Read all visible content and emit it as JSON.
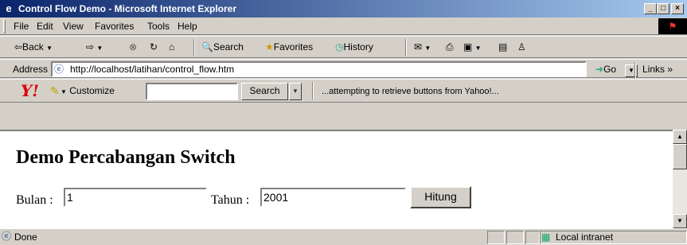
{
  "window": {
    "title": "Control Flow Demo - Microsoft Internet Explorer",
    "app_icon": "ie-icon",
    "controls": {
      "minimize": "_",
      "maximize": "□",
      "close": "×"
    }
  },
  "menu": {
    "items": [
      {
        "label": "File"
      },
      {
        "label": "Edit"
      },
      {
        "label": "View"
      },
      {
        "label": "Favorites"
      },
      {
        "label": "Tools"
      },
      {
        "label": "Help"
      }
    ]
  },
  "toolbar": {
    "back_label": "⇦Back",
    "search_label": "Search",
    "favorites_label": "Favorites",
    "history_label": "History"
  },
  "address": {
    "label": "Address",
    "url": "http://localhost/latihan/control_flow.htm",
    "go_label": "Go",
    "links_label": "Links"
  },
  "yahoo": {
    "logo": "Y!",
    "customize_label": "Customize",
    "search_button": "Search",
    "search_value": "",
    "message": "...attempting to retrieve buttons from Yahoo!..."
  },
  "page": {
    "heading": "Demo Percabangan Switch",
    "bulan_label": "Bulan :",
    "bulan_value": "1",
    "tahun_label": "Tahun :",
    "tahun_value": "2001",
    "hitung_label": "Hitung"
  },
  "status": {
    "text": "Done",
    "zone": "Local intranet"
  }
}
